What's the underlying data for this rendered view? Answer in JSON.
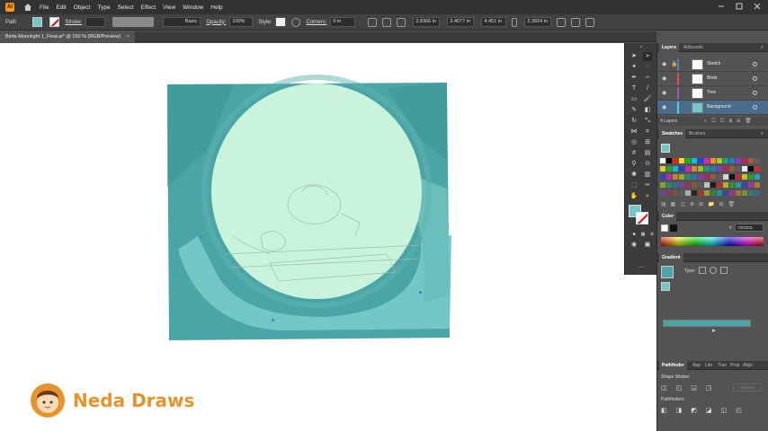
{
  "menubar": {
    "app_icon": "Ai",
    "items": [
      "File",
      "Edit",
      "Object",
      "Type",
      "Select",
      "Effect",
      "View",
      "Window",
      "Help"
    ]
  },
  "controlbar": {
    "selection_label": "Path",
    "stroke_label": "Stroke:",
    "brush_label": "Basic",
    "opacity_label": "Opacity:",
    "opacity_value": "100%",
    "style_label": "Style:",
    "corners_label": "Corners:",
    "corners_value": "0 in",
    "x_value": "2.8366 in",
    "y_value": "3.4077 in",
    "w_value": "4.451 in",
    "h_value": "2.3924 in"
  },
  "document": {
    "tab_title": "Birds-Moonlight 1_Final.ai* @ 150 % (RGB/Preview)",
    "tab_close": "×"
  },
  "layers_panel": {
    "tabs": [
      "Layers",
      "Artboards"
    ],
    "layers": [
      {
        "name": "Sketch",
        "color": "#4a7fd4",
        "selected": false
      },
      {
        "name": "Birds",
        "color": "#e64a4a",
        "selected": false
      },
      {
        "name": "Tree",
        "color": "#a84ad4",
        "selected": false
      },
      {
        "name": "Background",
        "color": "#4ad4d4",
        "selected": true
      }
    ],
    "count": "4 Layers"
  },
  "swatches_panel": {
    "tabs": [
      "Swatches",
      "Brushes"
    ]
  },
  "color_panel": {
    "title": "Color",
    "hex_value": "73C8C5"
  },
  "gradient_panel": {
    "title": "Gradient",
    "type_label": "Type:"
  },
  "pathfinder_panel": {
    "tabs": [
      "Pathfinder",
      "App",
      "Libr",
      "Tran",
      "Prop",
      "Align"
    ],
    "shape_modes_label": "Shape Modes:",
    "pathfinders_label": "Pathfinders:",
    "expand_label": "Expand"
  },
  "watermark": {
    "brand_text": "Neda Draws"
  },
  "colors": {
    "teal_dark": "#4aa6a6",
    "teal_mid": "#73c8c5",
    "moon": "#c9f3da",
    "brand_orange": "#e8922a"
  }
}
